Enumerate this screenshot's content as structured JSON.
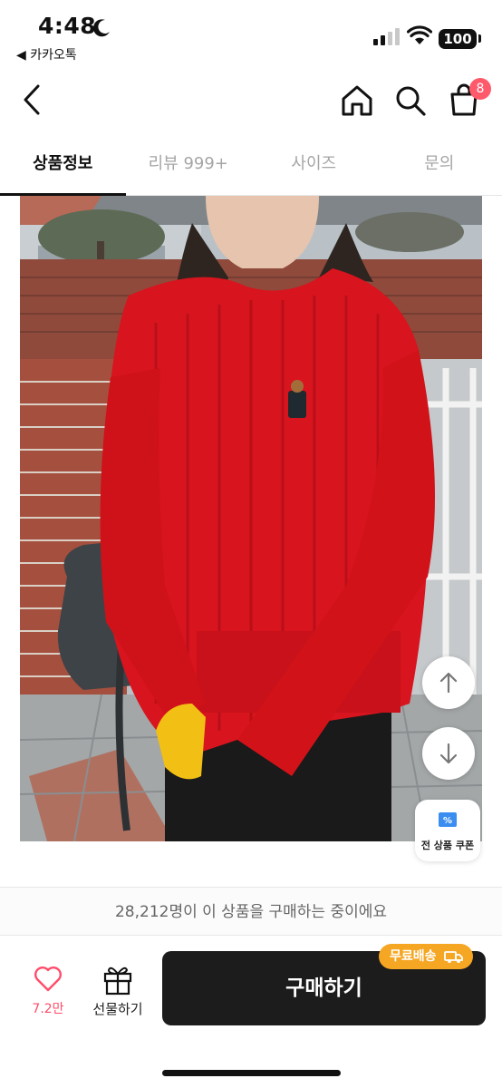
{
  "status_bar": {
    "time": "4:48",
    "back_to_app": "◀ 카카오톡",
    "battery": "100"
  },
  "nav": {
    "cart_badge": "8",
    "icons": [
      "back-icon",
      "home-icon",
      "search-icon",
      "shopping-bag-icon"
    ]
  },
  "tabs": [
    {
      "label": "상품정보",
      "active": true
    },
    {
      "label": "리뷰 999+",
      "active": false
    },
    {
      "label": "사이즈",
      "active": false
    },
    {
      "label": "문의",
      "active": false
    }
  ],
  "floating": {
    "coupon_label": "전 상품 쿠폰"
  },
  "buyers_text": "28,212명이 이 상품을 구매하는 중이에요",
  "bottom_bar": {
    "like_count": "7.2만",
    "gift_label": "선물하기",
    "buy_label": "구매하기",
    "free_shipping_badge": "무료배송"
  },
  "colors": {
    "accent_pink": "#ff5a6b",
    "like_pink": "#ff4d6a",
    "buy_button": "#1c1c1c",
    "shipping_badge": "#f5a623",
    "sweater_red": "#d8141e"
  }
}
